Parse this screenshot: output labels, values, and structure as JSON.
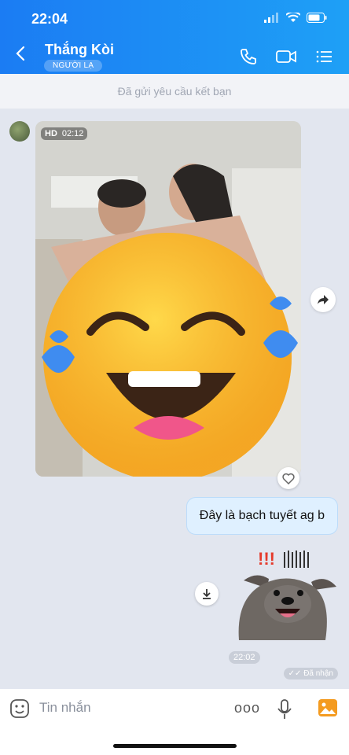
{
  "status_bar": {
    "time": "22:04"
  },
  "header": {
    "title": "Thắng Kòi",
    "badge": "NGƯỜI LẠ"
  },
  "friend_bar": {
    "text": "Đã gửi yêu cầu kết bạn"
  },
  "video": {
    "quality": "HD",
    "duration": "02:12"
  },
  "message_sent": {
    "text": "Đây là bạch tuyết ag b"
  },
  "sticker": {
    "exclaim": "!!!"
  },
  "meta": {
    "time": "22:02",
    "status": "Đã nhận"
  },
  "input": {
    "placeholder": "Tin nhắn",
    "more_label": "ooo"
  },
  "colors": {
    "header_start": "#1b7cf3",
    "header_end": "#1ea0f6",
    "bubble_bg": "#dff0ff",
    "background": "#e2e6ef"
  },
  "icons": [
    "chevron-left-icon",
    "phone-icon",
    "video-call-icon",
    "menu-icon",
    "share-icon",
    "heart-icon",
    "download-icon",
    "emoji-icon",
    "mic-icon",
    "image-icon"
  ]
}
